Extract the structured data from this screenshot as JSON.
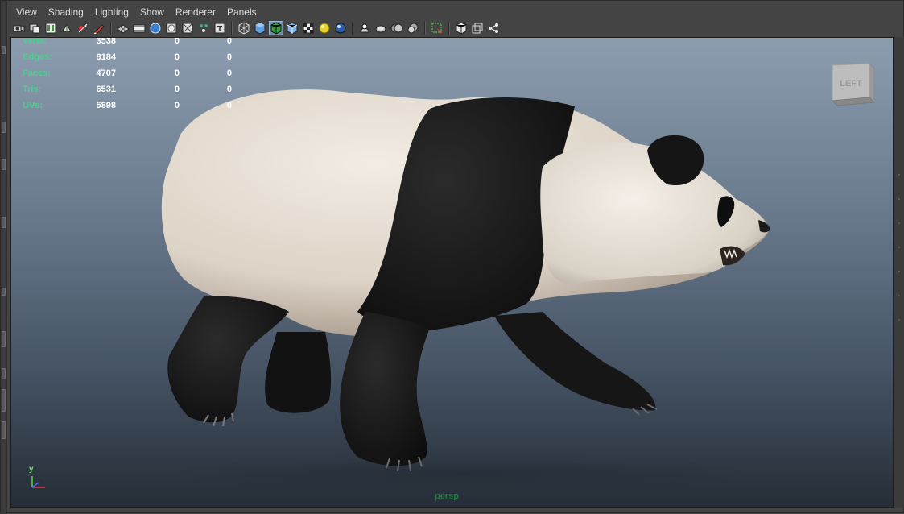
{
  "menu": [
    "View",
    "Shading",
    "Lighting",
    "Show",
    "Renderer",
    "Panels"
  ],
  "toolbar_groups": [
    [
      "camera-select-icon",
      "camera-attributes-icon",
      "bookmark-icon",
      "image-plane-icon",
      "2d-pan-zoom-icon",
      "grease-pencil-icon"
    ],
    [
      "grid-icon",
      "film-gate-icon",
      "resolution-gate-icon",
      "gate-mask-icon",
      "field-chart-icon",
      "safe-action-icon",
      "safe-title-icon"
    ],
    [
      "wireframe-icon",
      "smooth-shade-icon",
      "wireframe-on-shaded-icon",
      "default-material-icon",
      "textured-icon",
      "use-all-lights-icon",
      "shadows-icon"
    ],
    [
      "screen-space-ao-icon",
      "motion-blur-icon",
      "multisample-aa-icon",
      "depth-of-field-icon"
    ],
    [
      "isolate-select-icon"
    ],
    [
      "xray-icon",
      "xray-active-components-icon",
      "xray-joints-icon"
    ]
  ],
  "active_tools": [
    "wireframe-on-shaded-icon"
  ],
  "hud": [
    {
      "label": "Verts:",
      "values": [
        "3538",
        "0",
        "0"
      ]
    },
    {
      "label": "Edges:",
      "values": [
        "8184",
        "0",
        "0"
      ]
    },
    {
      "label": "Faces:",
      "values": [
        "4707",
        "0",
        "0"
      ]
    },
    {
      "label": "Tris:",
      "values": [
        "6531",
        "0",
        "0"
      ]
    },
    {
      "label": "UVs:",
      "values": [
        "5898",
        "0",
        "0"
      ]
    }
  ],
  "viewcube": {
    "face_label": "LEFT"
  },
  "camera": {
    "name": "persp"
  },
  "axis": {
    "y_label": "y"
  },
  "colors": {
    "hud_label": "#49d08c",
    "hud_value": "#ffffff",
    "camera_label": "#1e7a42",
    "viewport_top": "#8d9db0",
    "viewport_bottom": "#252d36"
  }
}
